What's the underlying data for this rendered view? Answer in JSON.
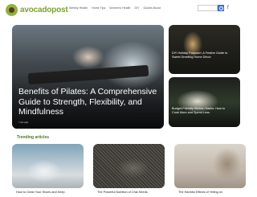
{
  "header": {
    "logo_text": "avocadopost",
    "nav": [
      "Weekly Health",
      "Home Tips",
      "Women's Health",
      "DIY",
      "Guides Boost"
    ],
    "search_placeholder": "",
    "social_icon": "facebook-icon",
    "social_glyph": "f"
  },
  "hero": {
    "title": "Benefits of Pilates: A Comprehensive Guide to Strength, Flexibility, and Mindfulness",
    "meta": "7 min read"
  },
  "side_articles": [
    {
      "title": "DIY Holiday Potpourri: A Festive Guide to Sweet-Smelling Home Décor"
    },
    {
      "title": "Budget-Friendly Kitchen Hacks: How to Cook More and Spend Less"
    }
  ],
  "trending": {
    "heading": "Trending articles",
    "articles": [
      {
        "title": "How to Clean Your Shoes and Keep"
      },
      {
        "title": "The Powerful Nutrition of Chia Seeds:"
      },
      {
        "title": "The Harmful Effects of Yelling on"
      }
    ]
  },
  "colors": {
    "brand_green": "#7fa32c",
    "heading_green": "#4a7a14",
    "search_blue": "#3b6fd8"
  }
}
